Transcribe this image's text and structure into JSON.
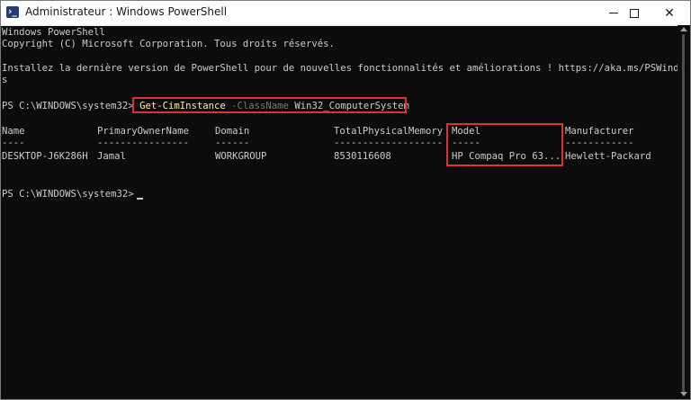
{
  "window": {
    "title": "Administrateur : Windows PowerShell",
    "minimize_glyph": "",
    "close_glyph": "✕"
  },
  "console": {
    "header_line1": "Windows PowerShell",
    "header_line2": "Copyright (C) Microsoft Corporation. Tous droits réservés.",
    "notice_line1": "Installez la dernière version de PowerShell pour de nouvelles fonctionnalités et améliorations ! https://aka.ms/PSWindow",
    "notice_line2": "s",
    "prompt": "PS C:\\WINDOWS\\system32>",
    "command": {
      "cmdlet": "Get-CimInstance",
      "parameter": "-ClassName",
      "argument": "Win32_ComputerSystem"
    },
    "table": {
      "headers": [
        "Name",
        "PrimaryOwnerName",
        "Domain",
        "TotalPhysicalMemory",
        "Model",
        "Manufacturer"
      ],
      "separators": [
        "----",
        "----------------",
        "------",
        "-------------------",
        "-----",
        "------------"
      ],
      "rows": [
        [
          "DESKTOP-J6K286H",
          "Jamal",
          "WORKGROUP",
          "8530116608",
          "HP Compaq Pro 63...",
          "Hewlett-Packard"
        ]
      ]
    },
    "final_prompt": "PS C:\\WINDOWS\\system32>"
  },
  "colors": {
    "background": "#0c0c0c",
    "text": "#cccccc",
    "cmdlet": "#f9f1a5",
    "parameter": "#767676",
    "highlight_box": "#d9352e"
  },
  "icons": {
    "app": "powershell-icon",
    "minimize": "minimize-icon",
    "maximize": "maximize-icon",
    "close": "close-icon"
  }
}
